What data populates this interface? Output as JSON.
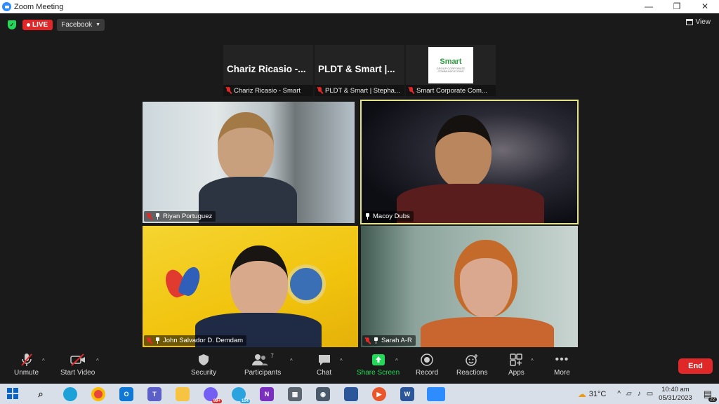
{
  "window": {
    "title": "Zoom Meeting",
    "controls": [
      "—",
      "❐",
      "✕"
    ]
  },
  "topbar": {
    "live_label": "LIVE",
    "stream_target": "Facebook",
    "view_label": "View"
  },
  "strip": [
    {
      "big_name": "Chariz Ricasio -...",
      "caption": "Chariz Ricasio - Smart"
    },
    {
      "big_name": "PLDT & Smart |...",
      "caption": "PLDT & Smart | Stepha..."
    },
    {
      "logo_text": "Smart",
      "logo_sub": "GROUP CORPORATE COMMUNICATIONS",
      "caption": "Smart Corporate Com..."
    }
  ],
  "tiles": [
    {
      "name": "Riyan Portuguez"
    },
    {
      "name": "Macoy Dubs"
    },
    {
      "name": "John Salvador D. Demdam"
    },
    {
      "name": "Sarah A-R"
    }
  ],
  "toolbar": {
    "unmute": "Unmute",
    "start_video": "Start Video",
    "security": "Security",
    "participants": "Participants",
    "participants_count": "7",
    "chat": "Chat",
    "share_screen": "Share Screen",
    "record": "Record",
    "reactions": "Reactions",
    "apps": "Apps",
    "more": "More",
    "end": "End"
  },
  "taskbar": {
    "temperature": "31°C",
    "time": "10:40 am",
    "date": "05/31/2023",
    "notification_count": "22",
    "badges": [
      "99+",
      "104"
    ]
  },
  "colors": {
    "accent_live": "#e02828",
    "share_green": "#23d959",
    "active_speaker_border": "#e3e38a"
  }
}
